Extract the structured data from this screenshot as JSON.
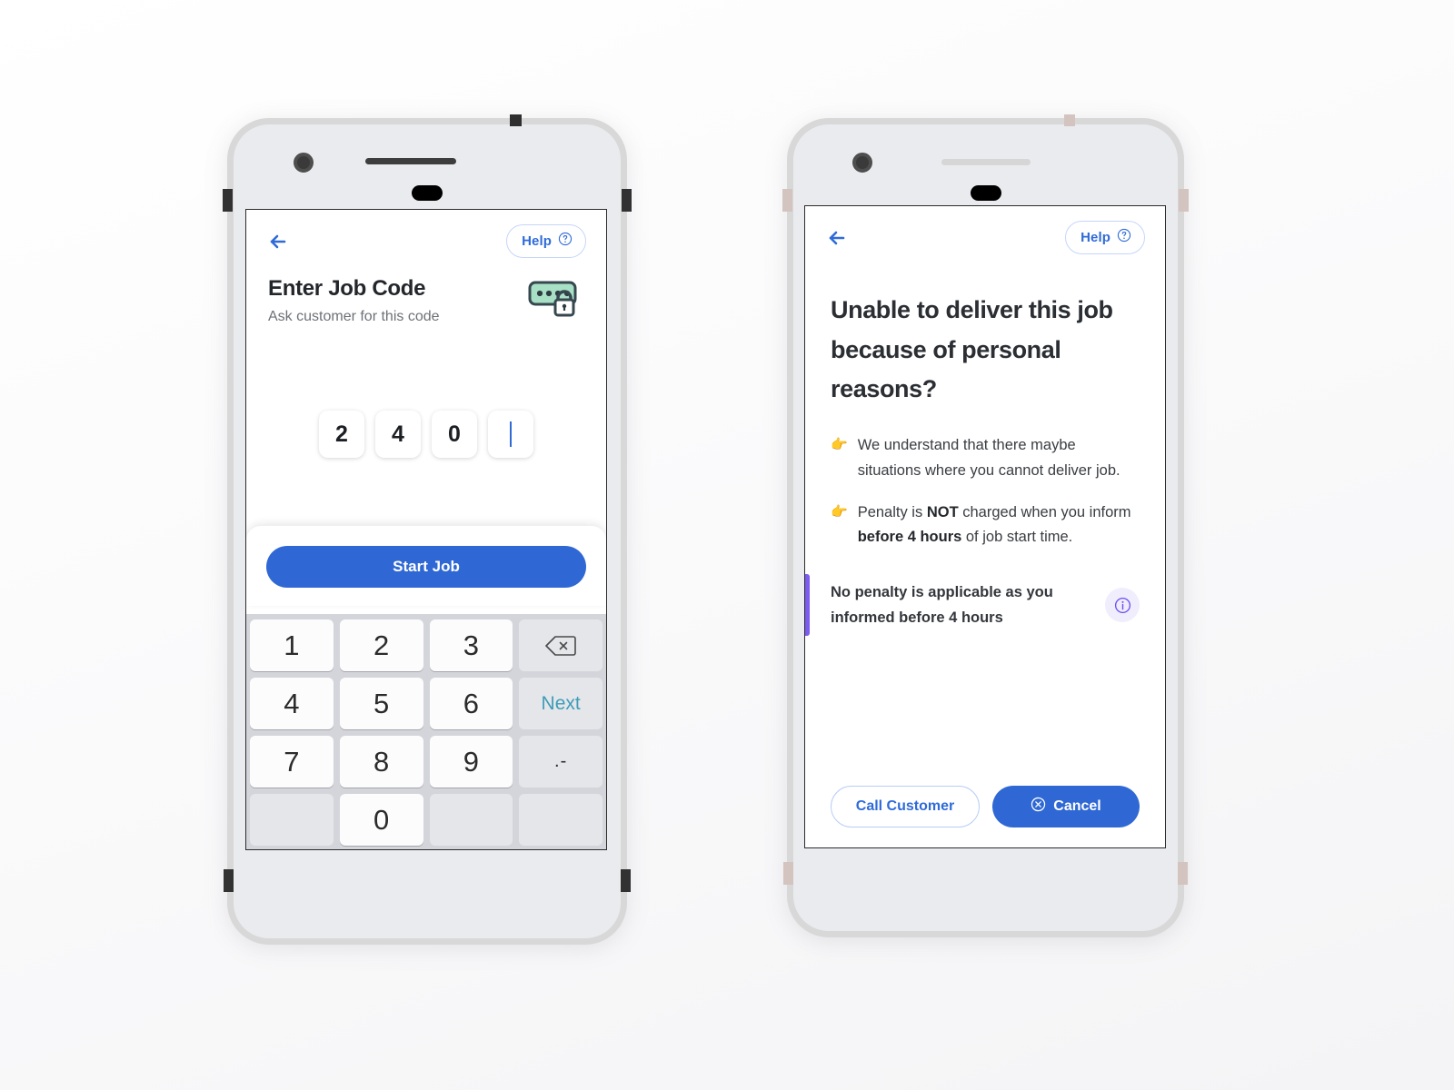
{
  "theme": {
    "primary_blue": "#2f68d4",
    "link_blue": "#2f6bd8",
    "purple_accent": "#7c5cf0",
    "keypad_bg": "#d3d5da",
    "next_key_teal": "#3f9cb8",
    "icon_mint": "#a8e0c6",
    "icon_outline": "#36474f",
    "page_bg": "#fbfbfc"
  },
  "left_phone": {
    "name": "enter-job-code-screen",
    "topbar": {
      "back_icon": "back-arrow-icon",
      "help_label": "Help",
      "help_icon": "question-circle-icon"
    },
    "header": {
      "title": "Enter Job Code",
      "subtitle": "Ask customer for this code",
      "illustration": "password-lock-icon"
    },
    "code_input": {
      "digits": [
        "2",
        "4",
        "0"
      ],
      "active_index": 3,
      "total_boxes": 4,
      "caret": "|"
    },
    "primary_action": {
      "label": "Start Job"
    },
    "keypad": {
      "rows": [
        [
          {
            "label": "1",
            "type": "num",
            "name": "key-1"
          },
          {
            "label": "2",
            "type": "num",
            "name": "key-2"
          },
          {
            "label": "3",
            "type": "num",
            "name": "key-3"
          },
          {
            "label": "⌫",
            "type": "fn",
            "name": "backspace-key"
          }
        ],
        [
          {
            "label": "4",
            "type": "num",
            "name": "key-4"
          },
          {
            "label": "5",
            "type": "num",
            "name": "key-5"
          },
          {
            "label": "6",
            "type": "num",
            "name": "key-6"
          },
          {
            "label": "Next",
            "type": "next",
            "name": "next-key"
          }
        ],
        [
          {
            "label": "7",
            "type": "num",
            "name": "key-7"
          },
          {
            "label": "8",
            "type": "num",
            "name": "key-8"
          },
          {
            "label": "9",
            "type": "num",
            "name": "key-9"
          },
          {
            "label": ".-",
            "type": "punct",
            "name": "punctuation-key"
          }
        ],
        [
          {
            "label": "",
            "type": "blank",
            "name": "blank-key-left"
          },
          {
            "label": "0",
            "type": "num",
            "name": "key-0"
          },
          {
            "label": "",
            "type": "blank",
            "name": "blank-key-mid"
          },
          {
            "label": "",
            "type": "blank",
            "name": "blank-key-right"
          }
        ]
      ]
    }
  },
  "right_phone": {
    "name": "unable-to-deliver-screen",
    "topbar": {
      "back_icon": "back-arrow-icon",
      "help_label": "Help",
      "help_icon": "question-circle-icon"
    },
    "title": "Unable to deliver this job because of personal reasons?",
    "bullets": [
      {
        "icon": "pointing-hand-icon",
        "glyph": "👉",
        "parts": [
          {
            "text": "We understand that there maybe situations where you cannot deliver job.",
            "bold": false
          }
        ]
      },
      {
        "icon": "pointing-hand-icon",
        "glyph": "👉",
        "parts": [
          {
            "text": "Penalty is ",
            "bold": false
          },
          {
            "text": "NOT",
            "bold": true
          },
          {
            "text": " charged when you inform ",
            "bold": false
          },
          {
            "text": "before 4 hours",
            "bold": true
          },
          {
            "text": " of job start time.",
            "bold": false
          }
        ]
      }
    ],
    "callout": {
      "text": "No penalty is applicable as you informed before 4 hours",
      "info_icon": "info-circle-icon"
    },
    "footer": {
      "secondary_label": "Call Customer",
      "primary_label": "Cancel",
      "primary_icon": "cancel-circle-icon"
    }
  }
}
